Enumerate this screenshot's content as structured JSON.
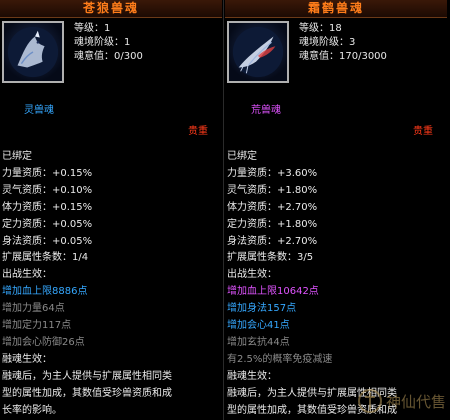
{
  "left": {
    "title": "苍狼兽魂",
    "image": "wolf-spirit-icon",
    "stats": [
      "等级：1",
      "魂境阶级：1",
      "魂意值：0/300"
    ],
    "type_label": "灵兽魂",
    "rarity": "贵重",
    "lines": [
      {
        "text": "已绑定",
        "color": "white"
      },
      {
        "text": "力量资质：+0.15%",
        "color": "white"
      },
      {
        "text": "灵气资质：+0.10%",
        "color": "white"
      },
      {
        "text": "体力资质：+0.15%",
        "color": "white"
      },
      {
        "text": "定力资质：+0.05%",
        "color": "white"
      },
      {
        "text": "身法资质：+0.05%",
        "color": "white"
      },
      {
        "text": "扩展属性条数：1/4",
        "color": "white"
      },
      {
        "text": "出战生效：",
        "color": "white"
      },
      {
        "text": "增加血上限8886点",
        "color": "blue"
      },
      {
        "text": "增加力量64点",
        "color": "gray"
      },
      {
        "text": "增加定力117点",
        "color": "gray"
      },
      {
        "text": "增加会心防御26点",
        "color": "gray"
      },
      {
        "text": "融魂生效：",
        "color": "white"
      }
    ],
    "desc_lines": [
      "融魂后，为主人提供与扩展属性相同类",
      "型的属性加成，其数值受珍兽资质和成",
      "长率的影响。"
    ]
  },
  "right": {
    "title": "霜鹤兽魂",
    "image": "crane-spirit-icon",
    "stats": [
      "等级：18",
      "魂境阶级：3",
      "魂意值：170/3000"
    ],
    "type_label": "荒兽魂",
    "rarity": "贵重",
    "lines": [
      {
        "text": "已绑定",
        "color": "white"
      },
      {
        "text": "力量资质：+3.60%",
        "color": "white"
      },
      {
        "text": "灵气资质：+1.80%",
        "color": "white"
      },
      {
        "text": "体力资质：+2.70%",
        "color": "white"
      },
      {
        "text": "定力资质：+1.80%",
        "color": "white"
      },
      {
        "text": "身法资质：+2.70%",
        "color": "white"
      },
      {
        "text": "扩展属性条数：3/5",
        "color": "white"
      },
      {
        "text": "出战生效：",
        "color": "white"
      },
      {
        "text": "增加血上限10642点",
        "color": "purple"
      },
      {
        "text": "增加身法157点",
        "color": "blue"
      },
      {
        "text": "增加会心41点",
        "color": "blue"
      },
      {
        "text": "增加玄抗44点",
        "color": "gray"
      },
      {
        "text": "有2.5%的概率免疫减速",
        "color": "gray"
      },
      {
        "text": "融魂生效：",
        "color": "white"
      }
    ],
    "desc_lines": [
      "融魂后，为主人提供与扩展属性相同类",
      "型的属性加成，其数值受珍兽资质和成"
    ]
  },
  "watermark": {
    "text": "神仙代售",
    "icon": "sword-shield-icon"
  },
  "colors": {
    "title": "#ff7d1a",
    "blue": "#35a8ff",
    "purple": "#e054ff",
    "gray": "#8a8a8a",
    "rarity": "#ff3a1a"
  }
}
